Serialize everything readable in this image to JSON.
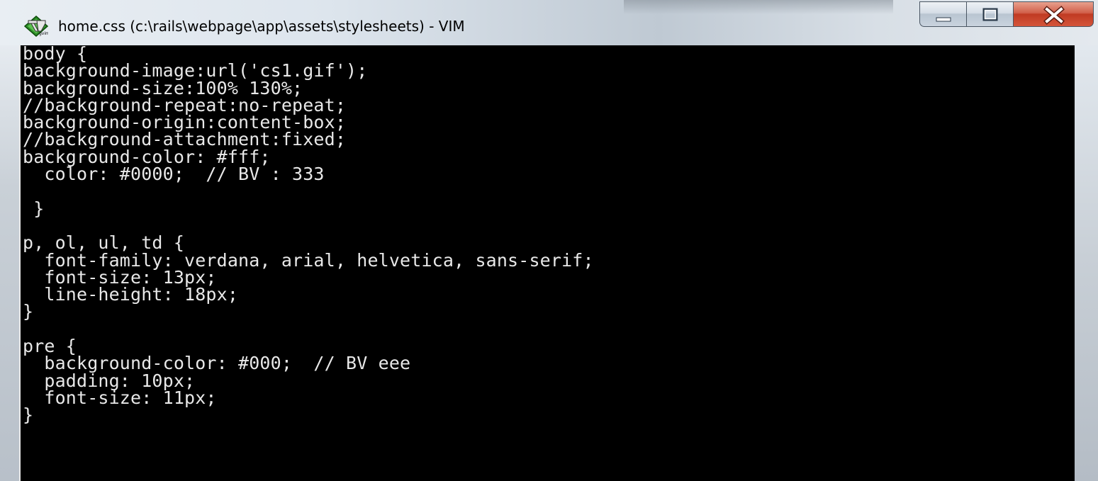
{
  "window": {
    "title": "home.css (c:\\rails\\webpage\\app\\assets\\stylesheets) - VIM",
    "app_icon": "vim-icon",
    "controls": {
      "minimize_icon": "minimize-icon",
      "maximize_icon": "maximize-icon",
      "close_icon": "close-icon"
    }
  },
  "editor": {
    "background": "#000000",
    "foreground": "#e8e8e8",
    "lines": [
      "body {",
      "background-image:url('cs1.gif');",
      "background-size:100% 130%;",
      "//background-repeat:no-repeat;",
      "background-origin:content-box;",
      "//background-attachment:fixed;",
      "background-color: #fff;",
      "  color: #0000;  // BV : 333",
      "",
      " }",
      "",
      "p, ol, ul, td {",
      "  font-family: verdana, arial, helvetica, sans-serif;",
      "  font-size: 13px;",
      "  line-height: 18px;",
      "}",
      "",
      "pre {",
      "  background-color: #000;  // BV eee",
      "  padding: 10px;",
      "  font-size: 11px;",
      "}"
    ]
  }
}
